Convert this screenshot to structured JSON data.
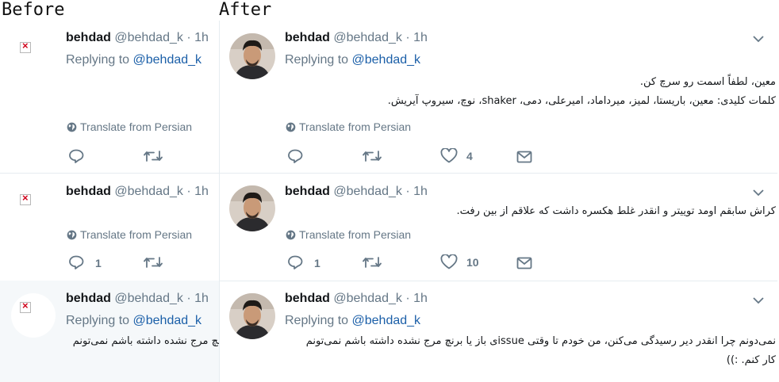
{
  "labels": {
    "before": "Before",
    "after": "After"
  },
  "tweets": [
    {
      "name": "behdad",
      "meta": "@behdad_k · 1h",
      "replying_prefix": "Replying to ",
      "replying_handle": "@behdad_k",
      "line1": "معین، لطفاً اسمت رو سرچ کن.",
      "line2": "کلمات کلیدی: معین، باریستا، لمیز، میرداماد، امیرعلی، دمی، shaker، نوچ، سیروپ آیریش.",
      "translate": "Translate from Persian",
      "reply_count": "",
      "like_count": "4"
    },
    {
      "name": "behdad",
      "meta": "@behdad_k · 1h",
      "line1": "کراش سابقم اومد توییتر و انقدر غلط هکسره داشت که علاقم از بین رفت.",
      "translate": "Translate from Persian",
      "reply_count": "1",
      "like_count": "10"
    },
    {
      "name": "behdad",
      "meta": "@behdad_k · 1h",
      "replying_prefix": "Replying to ",
      "replying_handle": "@behdad_k",
      "line1": "نمی‌دونم چرا انقدر دیر رسیدگی می‌کنن، من خودم تا وقتی issueی باز یا برنچ مرج نشده داشته باشم نمی‌تونم",
      "line2": "کار کنم. :))"
    }
  ],
  "icons": {
    "reply": "reply-icon",
    "retweet": "retweet-icon",
    "like": "heart-icon",
    "dm": "envelope-icon",
    "translate": "globe-icon",
    "caret": "chevron-down-icon",
    "broken_avatar": "broken-image-icon"
  }
}
